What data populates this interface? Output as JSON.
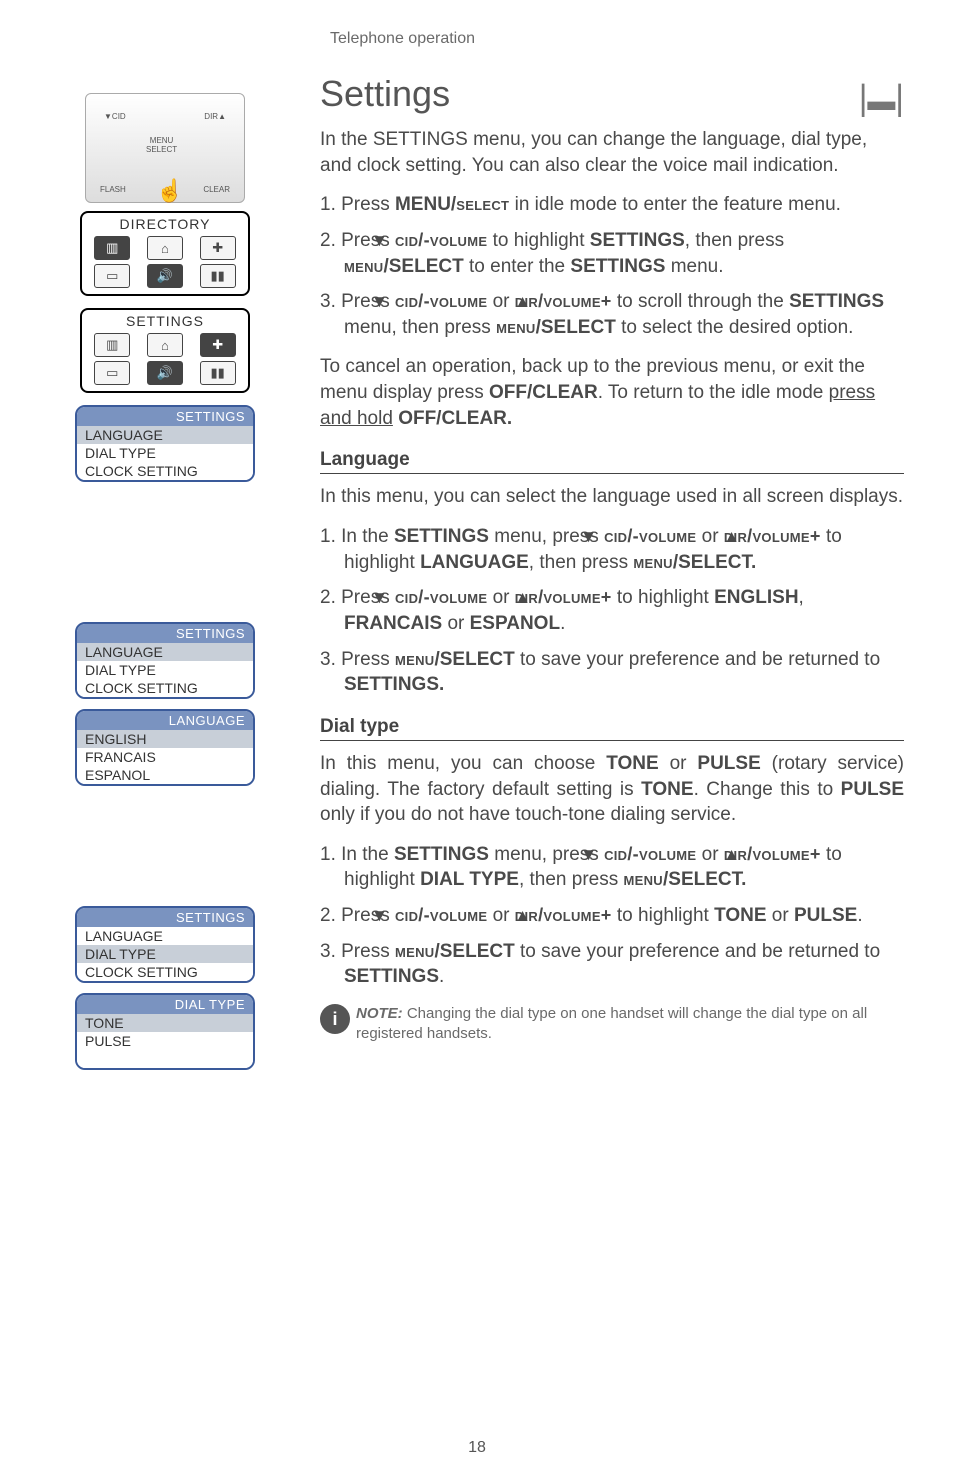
{
  "header": "Telephone operation",
  "title": "Settings",
  "intro": "In the SETTINGS menu, you can change the language, dial type, and clock setting. You can also clear the voice mail indication.",
  "main_steps": {
    "s1_a": "1. Press ",
    "s1_b": "MENU/",
    "s1_c": "select",
    "s1_d": " in idle mode to enter the feature menu.",
    "s2_a": "2. Press ",
    "s2_b": "cid/-volume",
    "s2_c": " to highlight ",
    "s2_d": "SETTINGS",
    "s2_e": ", then press ",
    "s2_f": "menu",
    "s2_g": "/SELECT",
    "s2_h": " to enter the ",
    "s2_i": "SETTINGS",
    "s2_j": " menu.",
    "s3_a": "3. Press ",
    "s3_b": "cid/-volume",
    "s3_c": " or ",
    "s3_d": "dir",
    "s3_e": "/volume+",
    "s3_f": " to scroll through the ",
    "s3_g": "SETTINGS",
    "s3_h": " menu, then press ",
    "s3_i": "menu",
    "s3_j": "/SELECT",
    "s3_k": " to select the desired option."
  },
  "cancel_a": "To cancel an operation, back up to the previous menu, or exit the menu display press ",
  "cancel_b": "OFF/CLEAR",
  "cancel_c": ". To return to the idle mode ",
  "cancel_d": "press and hold",
  "cancel_e": " ",
  "cancel_f": "OFF/CLEAR.",
  "lang": {
    "head": "Language",
    "intro": "In this menu, you can select the language used in all screen displays.",
    "s1_a": "1. In the ",
    "s1_b": "SETTINGS",
    "s1_c": " menu, press ",
    "s1_d": "cid/-volume",
    "s1_e": " or ",
    "s1_f": "dir",
    "s1_g": "/volume+",
    "s1_h": " to highlight ",
    "s1_i": "LANGUAGE",
    "s1_j": ", then press ",
    "s1_k": "menu",
    "s1_l": "/SELECT.",
    "s2_a": "2. Press ",
    "s2_b": "cid/-volume",
    "s2_c": " or ",
    "s2_d": "dir",
    "s2_e": "/volume+",
    "s2_f": " to highlight ",
    "s2_g": "ENGLISH",
    "s2_h": ", ",
    "s2_i": "FRANCAIS",
    "s2_j": "  or ",
    "s2_k": "ESPANOL",
    "s2_l": ".",
    "s3_a": "3. Press ",
    "s3_b": "menu",
    "s3_c": "/SELECT",
    "s3_d": " to save your preference and be returned to ",
    "s3_e": "SETTINGS."
  },
  "dial": {
    "head": "Dial type",
    "intro_a": "In this menu, you can choose ",
    "intro_b": "TONE",
    "intro_c": " or ",
    "intro_d": "PULSE",
    "intro_e": " (rotary service) dialing. The factory default setting is ",
    "intro_f": "TONE",
    "intro_g": ". Change this to ",
    "intro_h": "PULSE",
    "intro_i": " only if you do not have touch-tone dialing service.",
    "s1_a": "1. In the ",
    "s1_b": "SETTINGS",
    "s1_c": " menu, press ",
    "s1_d": "cid/-volume",
    "s1_e": " or ",
    "s1_f": "dir",
    "s1_g": "/volume+",
    "s1_h": " to highlight ",
    "s1_i": "DIAL TYPE",
    "s1_j": ", then press ",
    "s1_k": "menu",
    "s1_l": "/SELECT.",
    "s2_a": "2. Press ",
    "s2_b": "cid/-volume",
    "s2_c": " or ",
    "s2_d": "dir",
    "s2_e": "/volume+",
    "s2_f": " to highlight ",
    "s2_g": "TONE",
    "s2_h": " or ",
    "s2_i": "PULSE",
    "s2_j": ".",
    "s3_a": "3. Press ",
    "s3_b": "menu",
    "s3_c": "/SELECT",
    "s3_d": " to save your preference and be returned to ",
    "s3_e": "SETTINGS",
    "s3_f": "."
  },
  "note_label": "NOTE:",
  "note_text": " Changing the dial type on one handset will change the dial type on all registered handsets.",
  "page_num": "18",
  "screens": {
    "directory": {
      "title": "DIRECTORY"
    },
    "settings_lcd": {
      "title": "SETTINGS"
    },
    "settings_menu": {
      "title": "SETTINGS",
      "items": [
        "LANGUAGE",
        "DIAL TYPE",
        "CLOCK SETTING"
      ],
      "hl": 0
    },
    "settings_menu2": {
      "title": "SETTINGS",
      "items": [
        "LANGUAGE",
        "DIAL TYPE",
        "CLOCK SETTING"
      ],
      "hl": 0
    },
    "language_menu": {
      "title": "LANGUAGE",
      "items": [
        "ENGLISH",
        "FRANCAIS",
        "ESPANOL"
      ],
      "hl": 0
    },
    "settings_menu3": {
      "title": "SETTINGS",
      "items": [
        "LANGUAGE",
        "DIAL TYPE",
        "CLOCK SETTING"
      ],
      "hl": 1
    },
    "dialtype_menu": {
      "title": "DIAL TYPE",
      "items": [
        "TONE",
        "PULSE",
        ""
      ],
      "hl": 0
    }
  },
  "phone_labels": {
    "cid": "CID",
    "dir": "DIR",
    "menu": "MENU",
    "select": "SELECT",
    "flash": "FLASH",
    "clear": "CLEAR"
  }
}
